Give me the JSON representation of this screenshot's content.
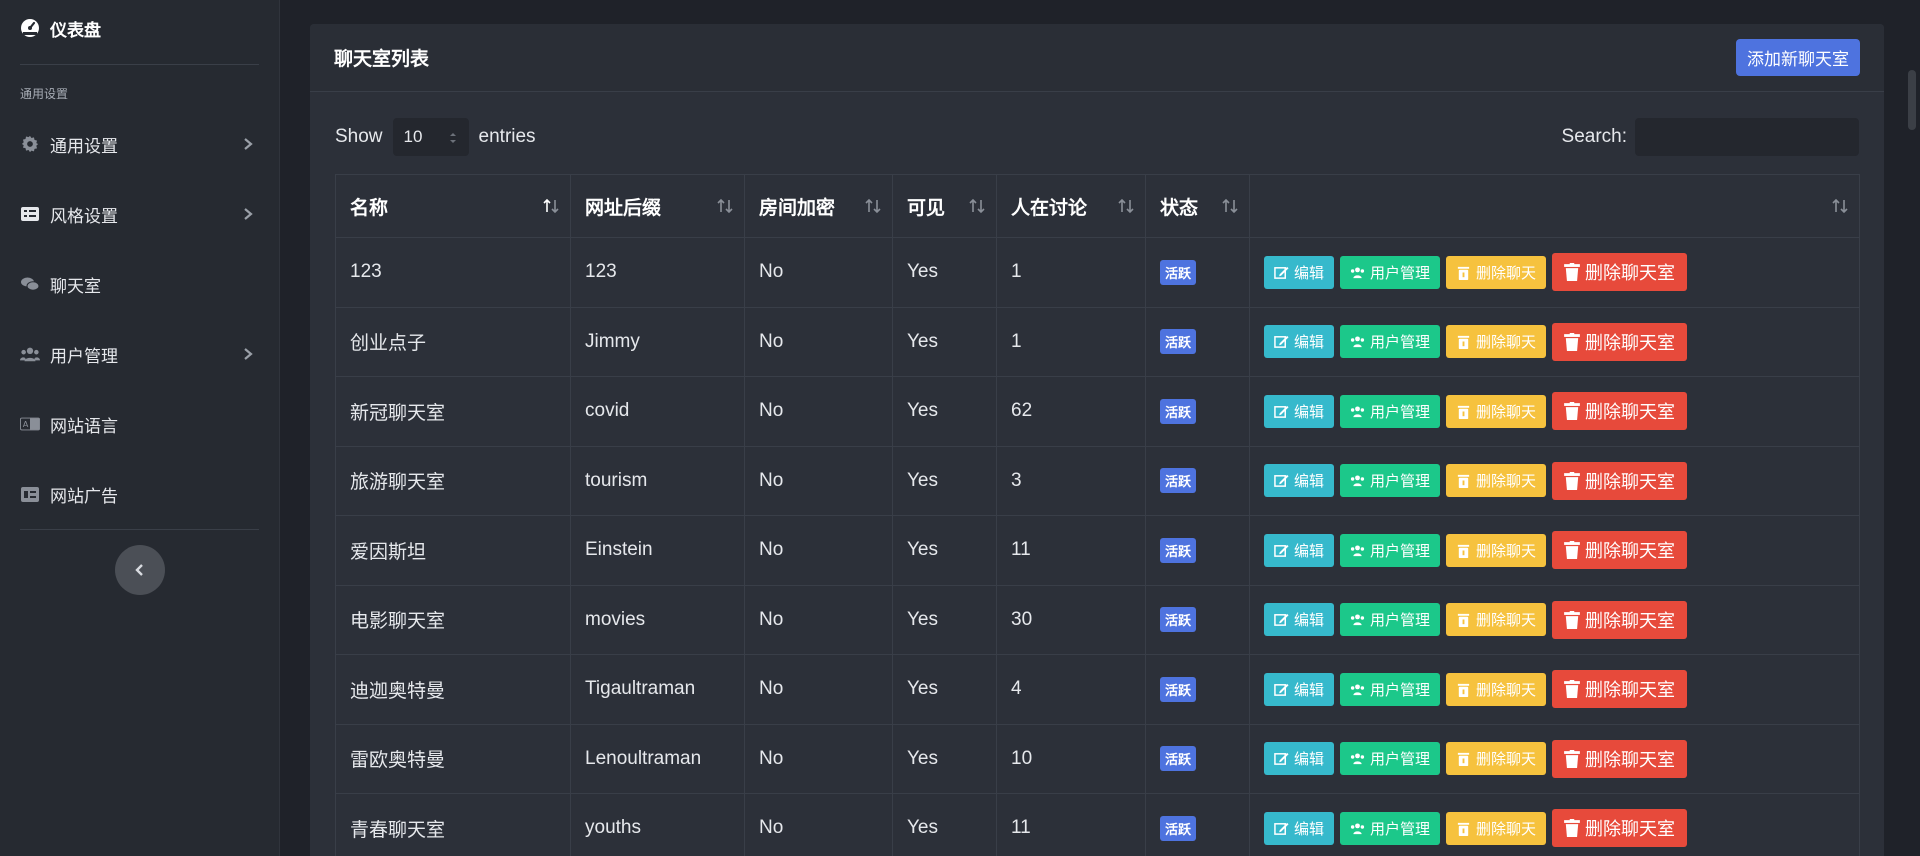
{
  "sidebar": {
    "brand": "仪表盘",
    "heading": "通用设置",
    "items": [
      {
        "label": "通用设置",
        "icon": "gear-icon",
        "chevron": true
      },
      {
        "label": "风格设置",
        "icon": "palette-icon",
        "chevron": true
      },
      {
        "label": "聊天室",
        "icon": "chat-icon",
        "chevron": false
      },
      {
        "label": "用户管理",
        "icon": "users-icon",
        "chevron": true
      },
      {
        "label": "网站语言",
        "icon": "language-icon",
        "chevron": false
      },
      {
        "label": "网站广告",
        "icon": "ad-icon",
        "chevron": false
      }
    ]
  },
  "card": {
    "title": "聊天室列表",
    "add_button": "添加新聊天室"
  },
  "controls": {
    "show_label": "Show",
    "entries_value": "10",
    "entries_label": "entries",
    "search_label": "Search:",
    "search_value": ""
  },
  "table": {
    "columns": [
      "名称",
      "网址后缀",
      "房间加密",
      "可见",
      "人在讨论",
      "状态",
      ""
    ],
    "rows": [
      {
        "name": "123",
        "slug": "123",
        "encrypted": "No",
        "visible": "Yes",
        "online": "1",
        "status": "活跃"
      },
      {
        "name": "创业点子",
        "slug": "Jimmy",
        "encrypted": "No",
        "visible": "Yes",
        "online": "1",
        "status": "活跃"
      },
      {
        "name": "新冠聊天室",
        "slug": "covid",
        "encrypted": "No",
        "visible": "Yes",
        "online": "62",
        "status": "活跃"
      },
      {
        "name": "旅游聊天室",
        "slug": "tourism",
        "encrypted": "No",
        "visible": "Yes",
        "online": "3",
        "status": "活跃"
      },
      {
        "name": "爱因斯坦",
        "slug": "Einstein",
        "encrypted": "No",
        "visible": "Yes",
        "online": "11",
        "status": "活跃"
      },
      {
        "name": "电影聊天室",
        "slug": "movies",
        "encrypted": "No",
        "visible": "Yes",
        "online": "30",
        "status": "活跃"
      },
      {
        "name": "迪迦奥特曼",
        "slug": "Tigaultraman",
        "encrypted": "No",
        "visible": "Yes",
        "online": "4",
        "status": "活跃"
      },
      {
        "name": "雷欧奥特曼",
        "slug": "Lenoultraman",
        "encrypted": "No",
        "visible": "Yes",
        "online": "10",
        "status": "活跃"
      },
      {
        "name": "青春聊天室",
        "slug": "youths",
        "encrypted": "No",
        "visible": "Yes",
        "online": "11",
        "status": "活跃"
      }
    ],
    "actions": {
      "edit": "编辑",
      "users": "用户管理",
      "delete_chat": "删除聊天",
      "delete_room": "删除聊天室"
    }
  },
  "colors": {
    "primary": "#4e73df",
    "info": "#36b9cc",
    "success": "#1cc88a",
    "warning": "#f6c23e",
    "danger": "#e74a3b"
  }
}
